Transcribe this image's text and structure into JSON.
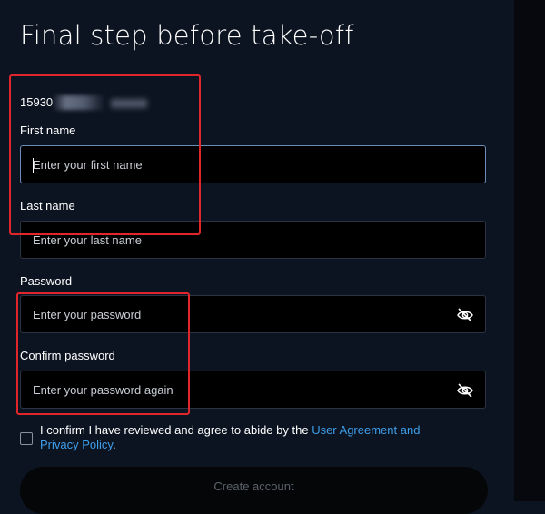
{
  "page": {
    "title": "Final step before take-off"
  },
  "account": {
    "email": "15930"
  },
  "fields": {
    "first_name": {
      "label": "First name",
      "placeholder": "Enter your first name",
      "value": ""
    },
    "last_name": {
      "label": "Last name",
      "placeholder": "Enter your last name",
      "value": ""
    },
    "password": {
      "label": "Password",
      "placeholder": "Enter your password",
      "value": ""
    },
    "confirm_password": {
      "label": "Confirm password",
      "placeholder": "Enter your password again",
      "value": ""
    }
  },
  "consent": {
    "checked": false,
    "text_before": "I confirm I have reviewed and agree to abide by the ",
    "link_part1": "User Agreement and",
    "link_part2": "Privacy Policy",
    "text_after": "."
  },
  "actions": {
    "create_label": "Create account"
  },
  "icons": {
    "password_toggle": "eye-slash-icon"
  },
  "colors": {
    "background": "#0d1421",
    "input_background": "#000000",
    "link": "#3d9eea",
    "annotation": "#e0262a",
    "focused_border": "#6b8db8"
  }
}
